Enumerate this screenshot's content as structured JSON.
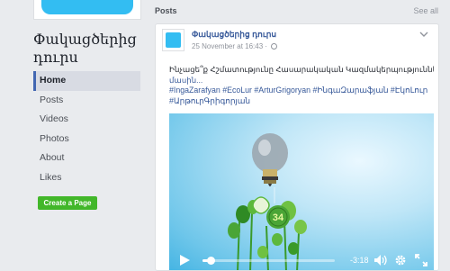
{
  "page": {
    "name": "Փակացծերից դուրս"
  },
  "nav": {
    "items": [
      {
        "label": "Home",
        "active": true
      },
      {
        "label": "Posts",
        "active": false
      },
      {
        "label": "Videos",
        "active": false
      },
      {
        "label": "Photos",
        "active": false
      },
      {
        "label": "About",
        "active": false
      },
      {
        "label": "Likes",
        "active": false
      }
    ],
    "create_page_label": "Create a Page"
  },
  "posts": {
    "title": "Posts",
    "see_all": "See all"
  },
  "post": {
    "author": "Փակացծերից դուրս",
    "date": "25 November at 16:43 ·",
    "text_line1": "Ինչացե՞ք Հշմատությունը Հասարակական Կազմակերպությունների",
    "text_line2": "մասին...",
    "hashtags": [
      "#IngaZarafyan",
      "#EcoLur",
      "#ArturGrigoryan",
      "#ԻնգաԶարաֆյան",
      "#ԷկոԼուր",
      "#ԱրթուրԳրիգորյան"
    ]
  },
  "video": {
    "time_remaining": "-3:18",
    "progress_fraction": 0.06,
    "logo_text": "34"
  },
  "icons": {
    "chevron": "chevron-down-icon",
    "globe": "globe-icon",
    "play": "play-icon",
    "volume": "volume-icon",
    "settings": "gear-icon",
    "fullscreen": "fullscreen-icon"
  },
  "colors": {
    "accent": "#4267b2",
    "link": "#365899",
    "brand_blue": "#33bdf2",
    "create_green": "#42b72a",
    "background": "#e9ebee"
  }
}
